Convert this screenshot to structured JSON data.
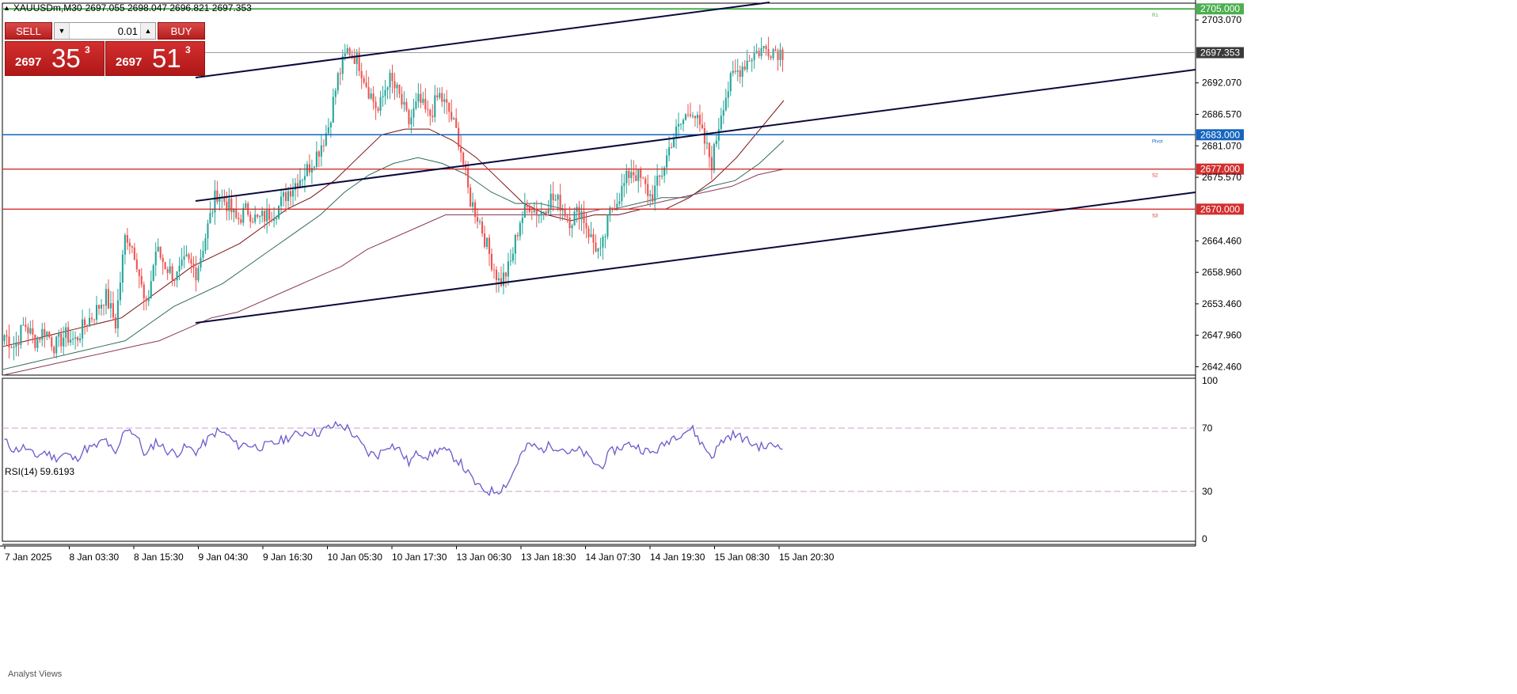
{
  "header": {
    "symbol_timeframe": "XAUUSDm,M30",
    "ohlc": "2697.055 2698.047 2696.821 2697.353"
  },
  "trade_panel": {
    "sell_label": "SELL",
    "buy_label": "BUY",
    "lot_value": "0.01",
    "sell_price_small": "2697",
    "sell_price_big": "35",
    "sell_price_sup": "3",
    "buy_price_small": "2697",
    "buy_price_big": "51",
    "buy_price_sup": "3"
  },
  "colors": {
    "bull": "#26a69a",
    "bear": "#ef5350",
    "pivot_line": "#1565c0",
    "support_line": "#d32f2f",
    "r1_line": "#4caf50",
    "channel": "#0a0a3c",
    "ma_fast": "#7b1010",
    "ma_mid": "#2e6b57",
    "ma_slow": "#8a3a5a",
    "rsi": "#6a5acd",
    "current_price_box": "#3a3a3a"
  },
  "rsi": {
    "label": "RSI(14) 59.6193",
    "levels": [
      100,
      70,
      30,
      0
    ],
    "level_labels": [
      "100",
      "70",
      "30",
      "0"
    ]
  },
  "analyst_label": "Analyst Views",
  "chart_data": {
    "type": "candlestick",
    "symbol": "XAUUSDm",
    "timeframe": "M30",
    "y_ticks": [
      2703.07,
      2692.07,
      2686.57,
      2681.07,
      2675.57,
      2664.46,
      2658.96,
      2653.46,
      2647.96,
      2642.46
    ],
    "y_tick_labels": [
      "2703.070",
      "2692.070",
      "2686.570",
      "2681.070",
      "2675.570",
      "2664.460",
      "2658.960",
      "2653.460",
      "2647.960",
      "2642.460"
    ],
    "price_tags": [
      {
        "value": 2705.0,
        "label": "2705.000",
        "level": "R1",
        "kind": "r1"
      },
      {
        "value": 2697.353,
        "label": "2697.353",
        "level": "",
        "kind": "current"
      },
      {
        "value": 2683.0,
        "label": "2683.000",
        "level": "Pivot",
        "kind": "pivot"
      },
      {
        "value": 2677.0,
        "label": "2677.000",
        "level": "S2",
        "kind": "support"
      },
      {
        "value": 2670.0,
        "label": "2670.000",
        "level": "S3",
        "kind": "support"
      }
    ],
    "x_labels": [
      "7 Jan 2025",
      "8 Jan 03:30",
      "8 Jan 15:30",
      "9 Jan 04:30",
      "9 Jan 16:30",
      "10 Jan 05:30",
      "10 Jan 17:30",
      "13 Jan 06:30",
      "13 Jan 18:30",
      "14 Jan 07:30",
      "14 Jan 19:30",
      "15 Jan 08:30",
      "15 Jan 20:30"
    ],
    "close_path": [
      2648,
      2646,
      2650,
      2647,
      2649,
      2646,
      2648,
      2647,
      2650,
      2652,
      2655,
      2650,
      2666,
      2662,
      2652,
      2663,
      2660,
      2658,
      2661,
      2659,
      2666,
      2673,
      2671,
      2668,
      2670,
      2668,
      2669,
      2670,
      2673,
      2675,
      2677,
      2680,
      2684,
      2693,
      2698,
      2696,
      2691,
      2687,
      2693,
      2690,
      2685,
      2689,
      2686,
      2690,
      2687,
      2682,
      2672,
      2668,
      2662,
      2657,
      2660,
      2668,
      2671,
      2669,
      2672,
      2671,
      2668,
      2670,
      2665,
      2662,
      2670,
      2673,
      2677,
      2675,
      2672,
      2676,
      2682,
      2685,
      2688,
      2683,
      2678,
      2688,
      2693,
      2695,
      2697,
      2698,
      2698,
      2697.353
    ],
    "moving_averages": [
      {
        "key": "ma_fast",
        "values": [
          2646,
          2647,
          2648,
          2649,
          2650,
          2651,
          2654,
          2657,
          2660,
          2662,
          2664,
          2667,
          2670,
          2672,
          2675,
          2679,
          2683,
          2684,
          2684,
          2682,
          2679,
          2675,
          2671,
          2669,
          2668,
          2669,
          2669,
          2670,
          2670,
          2672,
          2675,
          2679,
          2684,
          2689
        ]
      },
      {
        "key": "ma_mid",
        "values": [
          2642,
          2643,
          2644,
          2645,
          2646,
          2647,
          2650,
          2653,
          2655,
          2657,
          2660,
          2663,
          2666,
          2669,
          2673,
          2676,
          2678,
          2679,
          2678,
          2676,
          2673,
          2671,
          2671,
          2670,
          2670,
          2670,
          2671,
          2672,
          2672,
          2674,
          2675,
          2678,
          2682
        ]
      },
      {
        "key": "ma_slow",
        "values": [
          2641,
          2642,
          2643,
          2644,
          2645,
          2646,
          2647,
          2649,
          2651,
          2652,
          2654,
          2656,
          2658,
          2660,
          2663,
          2665,
          2667,
          2669,
          2669,
          2669,
          2669,
          2669,
          2669,
          2670,
          2670,
          2671,
          2672,
          2673,
          2674,
          2676,
          2677
        ]
      }
    ],
    "rsi_path": [
      62,
      56,
      58,
      52,
      55,
      51,
      54,
      50,
      57,
      58,
      63,
      52,
      71,
      66,
      52,
      62,
      56,
      54,
      58,
      55,
      62,
      68,
      66,
      59,
      60,
      58,
      59,
      61,
      64,
      66,
      68,
      67,
      70,
      72,
      70,
      62,
      54,
      53,
      60,
      57,
      48,
      55,
      52,
      57,
      54,
      49,
      40,
      32,
      30,
      31,
      37,
      52,
      60,
      56,
      59,
      58,
      54,
      56,
      50,
      45,
      55,
      58,
      60,
      57,
      54,
      58,
      64,
      67,
      70,
      60,
      52,
      62,
      66,
      64,
      60,
      58,
      59,
      59.6
    ]
  }
}
